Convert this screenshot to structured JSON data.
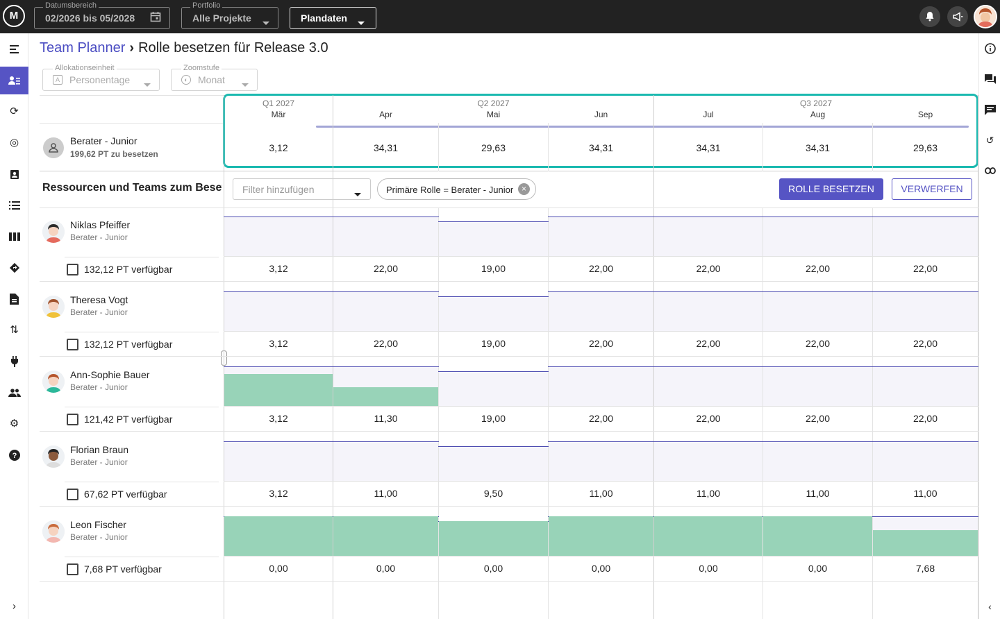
{
  "topbar": {
    "logo": "M",
    "date_range": {
      "label": "Datumsbereich",
      "value": "02/2026 bis 05/2028"
    },
    "portfolio": {
      "label": "Portfolio",
      "value": "Alle Projekte"
    },
    "data_mode": "Plandaten"
  },
  "breadcrumb": {
    "parent": "Team Planner",
    "current": "Rolle besetzen für Release 3.0"
  },
  "controls": {
    "allocation": {
      "label": "Allokationseinheit",
      "value": "Personentage"
    },
    "zoom": {
      "label": "Zoomstufe",
      "value": "Monat"
    }
  },
  "timeline": {
    "quarters": [
      {
        "label": "Q1 2027"
      },
      {
        "label": "Q2 2027"
      },
      {
        "label": "Q3 2027"
      }
    ],
    "months": [
      "Mär",
      "Apr",
      "Mai",
      "Jun",
      "Jul",
      "Aug",
      "Sep"
    ]
  },
  "role": {
    "name": "Berater - Junior",
    "to_fill": "199,62 PT zu besetzen",
    "values": [
      "3,12",
      "34,31",
      "29,63",
      "34,31",
      "34,31",
      "34,31",
      "29,63"
    ]
  },
  "section": {
    "title": "Ressourcen und Teams zum Besetzen",
    "filter_placeholder": "Filter hinzufügen",
    "chip": "Primäre Rolle = Berater - Junior",
    "primary_button": "ROLLE BESETZEN",
    "secondary_button": "VERWERFEN"
  },
  "resources": [
    {
      "name": "Niklas Pfeiffer",
      "role": "Berater - Junior",
      "available": "132,12 PT verfügbar",
      "values": [
        "3,12",
        "22,00",
        "19,00",
        "22,00",
        "22,00",
        "22,00",
        "22,00"
      ],
      "allocation_fraction": [
        0,
        0,
        0,
        0,
        0,
        0,
        0
      ]
    },
    {
      "name": "Theresa Vogt",
      "role": "Berater - Junior",
      "available": "132,12 PT verfügbar",
      "values": [
        "3,12",
        "22,00",
        "19,00",
        "22,00",
        "22,00",
        "22,00",
        "22,00"
      ],
      "allocation_fraction": [
        0,
        0,
        0,
        0,
        0,
        0,
        0
      ]
    },
    {
      "name": "Ann-Sophie Bauer",
      "role": "Berater - Junior",
      "available": "121,42 PT verfügbar",
      "values": [
        "3,12",
        "11,30",
        "19,00",
        "22,00",
        "22,00",
        "22,00",
        "22,00"
      ],
      "allocation_fraction": [
        0.8,
        0.48,
        0,
        0,
        0,
        0,
        0
      ]
    },
    {
      "name": "Florian Braun",
      "role": "Berater - Junior",
      "available": "67,62 PT verfügbar",
      "values": [
        "3,12",
        "11,00",
        "9,50",
        "11,00",
        "11,00",
        "11,00",
        "11,00"
      ],
      "allocation_fraction": [
        0,
        0,
        0,
        0,
        0,
        0,
        0
      ]
    },
    {
      "name": "Leon Fischer",
      "role": "Berater - Junior",
      "available": "7,68 PT verfügbar",
      "values": [
        "0,00",
        "0,00",
        "0,00",
        "0,00",
        "0,00",
        "0,00",
        "7,68"
      ],
      "allocation_fraction": [
        1,
        1,
        1,
        1,
        1,
        1,
        0.65
      ]
    }
  ],
  "colors": {
    "accent": "#5654c4",
    "highlight": "#1bb9b0",
    "allocation": "#98d3b8",
    "topbar": "#222222"
  }
}
